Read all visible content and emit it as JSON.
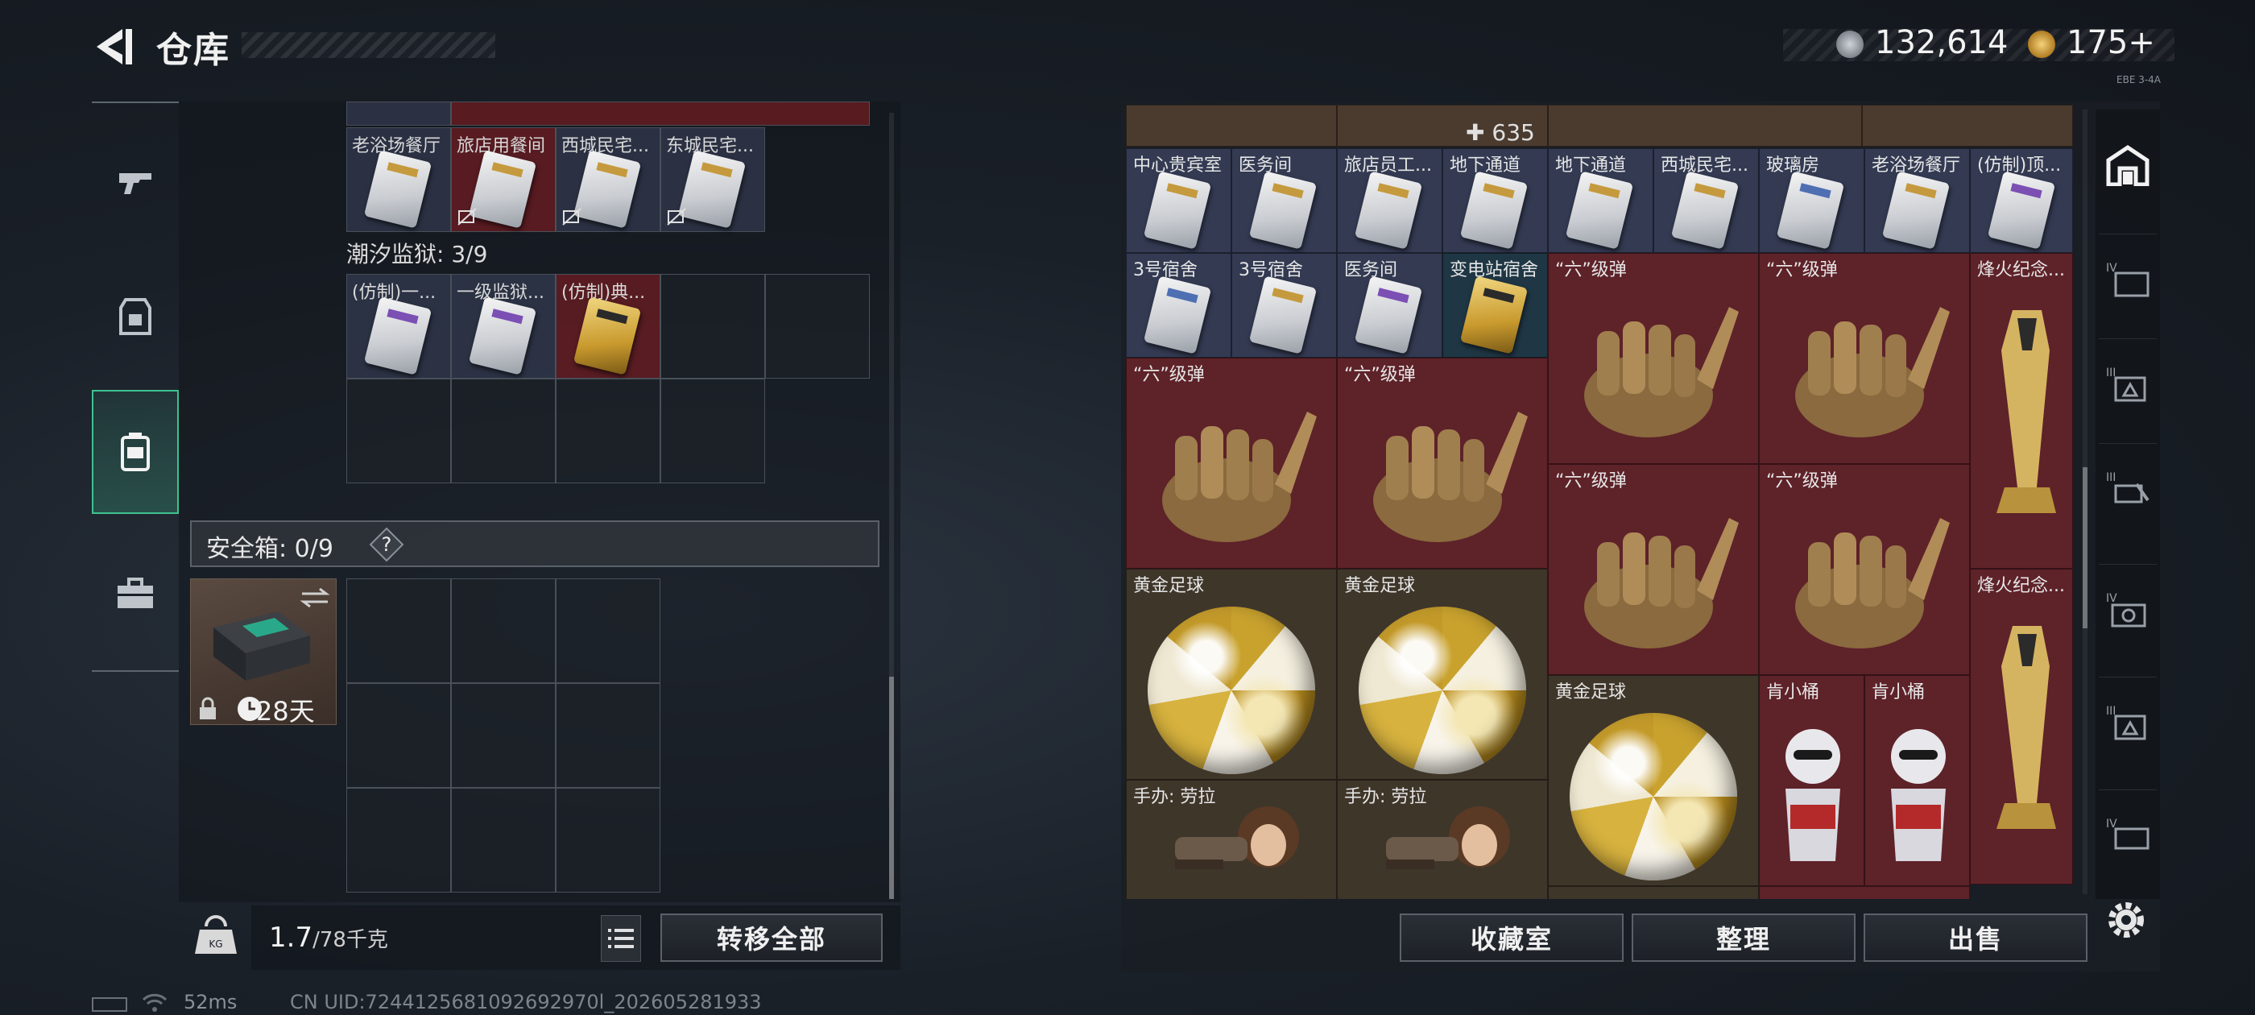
{
  "header": {
    "title": "仓库",
    "back_icon": "back-arrow-icon"
  },
  "currency": {
    "coin_value": "132,614",
    "gold_value": "175+",
    "corner_label": "EBE 3-4A"
  },
  "left_nav": [
    {
      "name": "weapons",
      "icon": "gun-icon"
    },
    {
      "name": "armor",
      "icon": "vest-icon"
    },
    {
      "name": "backpack",
      "icon": "backpack-icon",
      "active": true
    },
    {
      "name": "container",
      "icon": "briefcase-icon"
    }
  ],
  "left_panel": {
    "top_row": [
      {
        "label": "老浴场餐厅",
        "color": "blue",
        "nodrop": false
      },
      {
        "label": "旅店用餐间",
        "color": "red",
        "nodrop": true
      },
      {
        "label": "西城民宅...",
        "color": "blue",
        "nodrop": true
      },
      {
        "label": "东城民宅...",
        "color": "blue",
        "nodrop": true
      }
    ],
    "prison_label": "潮汐监狱: 3/9",
    "prison_row": [
      {
        "label": "(仿制)一...",
        "color": "blue",
        "style": "purple"
      },
      {
        "label": "一级监狱...",
        "color": "blue",
        "style": "purple"
      },
      {
        "label": "(仿制)典...",
        "color": "red",
        "style": "gold"
      }
    ],
    "safebox": {
      "label": "安全箱: 0/9",
      "help": "?",
      "days": "28天"
    }
  },
  "left_bottom": {
    "weight": "1.7",
    "weight_max": "/78千克",
    "transfer_all": "转移全部"
  },
  "right_panel": {
    "count": "635",
    "row1": [
      {
        "label": "中心贵宾室",
        "color": "blue"
      },
      {
        "label": "医务间",
        "color": "blue"
      },
      {
        "label": "旅店员工...",
        "color": "blue"
      },
      {
        "label": "地下通道",
        "color": "blue"
      },
      {
        "label": "地下通道",
        "color": "blue"
      },
      {
        "label": "西城民宅...",
        "color": "blue"
      },
      {
        "label": "玻璃房",
        "color": "blue"
      },
      {
        "label": "老浴场餐厅",
        "color": "blue"
      },
      {
        "label": "(仿制)顶...",
        "color": "blue"
      }
    ],
    "row2": [
      {
        "label": "3号宿舍",
        "color": "blue"
      },
      {
        "label": "3号宿舍",
        "color": "blue"
      },
      {
        "label": "医务间",
        "color": "blue"
      },
      {
        "label": "变电站宿舍",
        "color": "teal"
      }
    ],
    "grenade_label": "“六”级弹",
    "torch_label": "烽火纪念...",
    "ball_label": "黄金足球",
    "kfc_label": "肯小桶",
    "figure_label": "手办: 劳拉",
    "buttons": {
      "collection": "收藏室",
      "organize": "整理",
      "sell": "出售"
    }
  },
  "status_bar": {
    "ping": "52ms",
    "uid": "CN UID:7244125681092692970l_202605281933"
  },
  "colors": {
    "accent": "#3ec28f",
    "red_cell": "#5e2229",
    "blue_cell": "#333a52"
  }
}
